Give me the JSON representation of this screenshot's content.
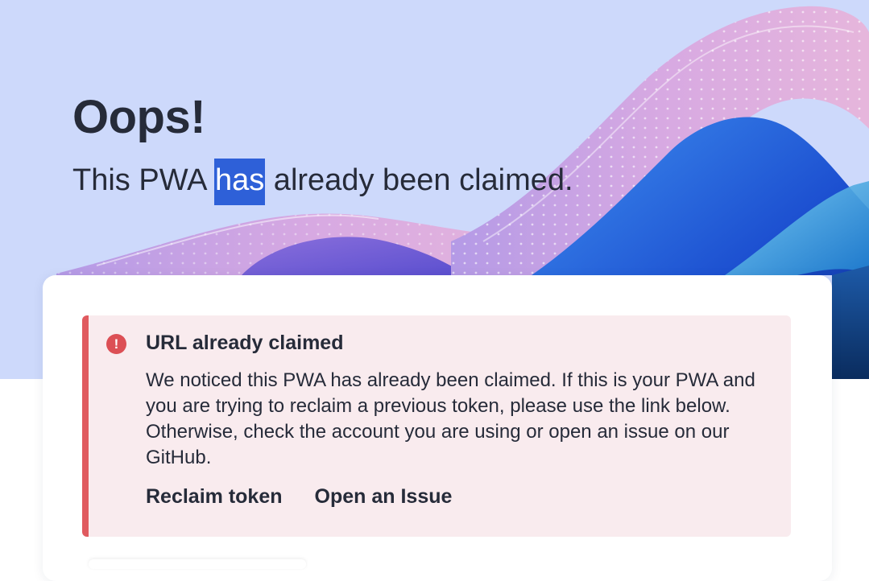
{
  "hero": {
    "title": "Oops!",
    "subtitle_before": "This PWA ",
    "subtitle_selected": "has",
    "subtitle_after": " already been claimed."
  },
  "alert": {
    "icon": "exclamation-circle-icon",
    "icon_glyph": "!",
    "title": "URL already claimed",
    "body": "We noticed this PWA has already been claimed. If this is your PWA and you are trying to reclaim a previous token, please use the link below. Otherwise, check the account you are using or open an issue on our GitHub.",
    "actions": {
      "reclaim": "Reclaim token",
      "issue": "Open an Issue"
    }
  },
  "colors": {
    "hero_bg": "#cdd9fb",
    "alert_bg": "#f9ebee",
    "alert_accent": "#e05a5f",
    "text": "#262b39",
    "selection": "#2e60d8"
  }
}
